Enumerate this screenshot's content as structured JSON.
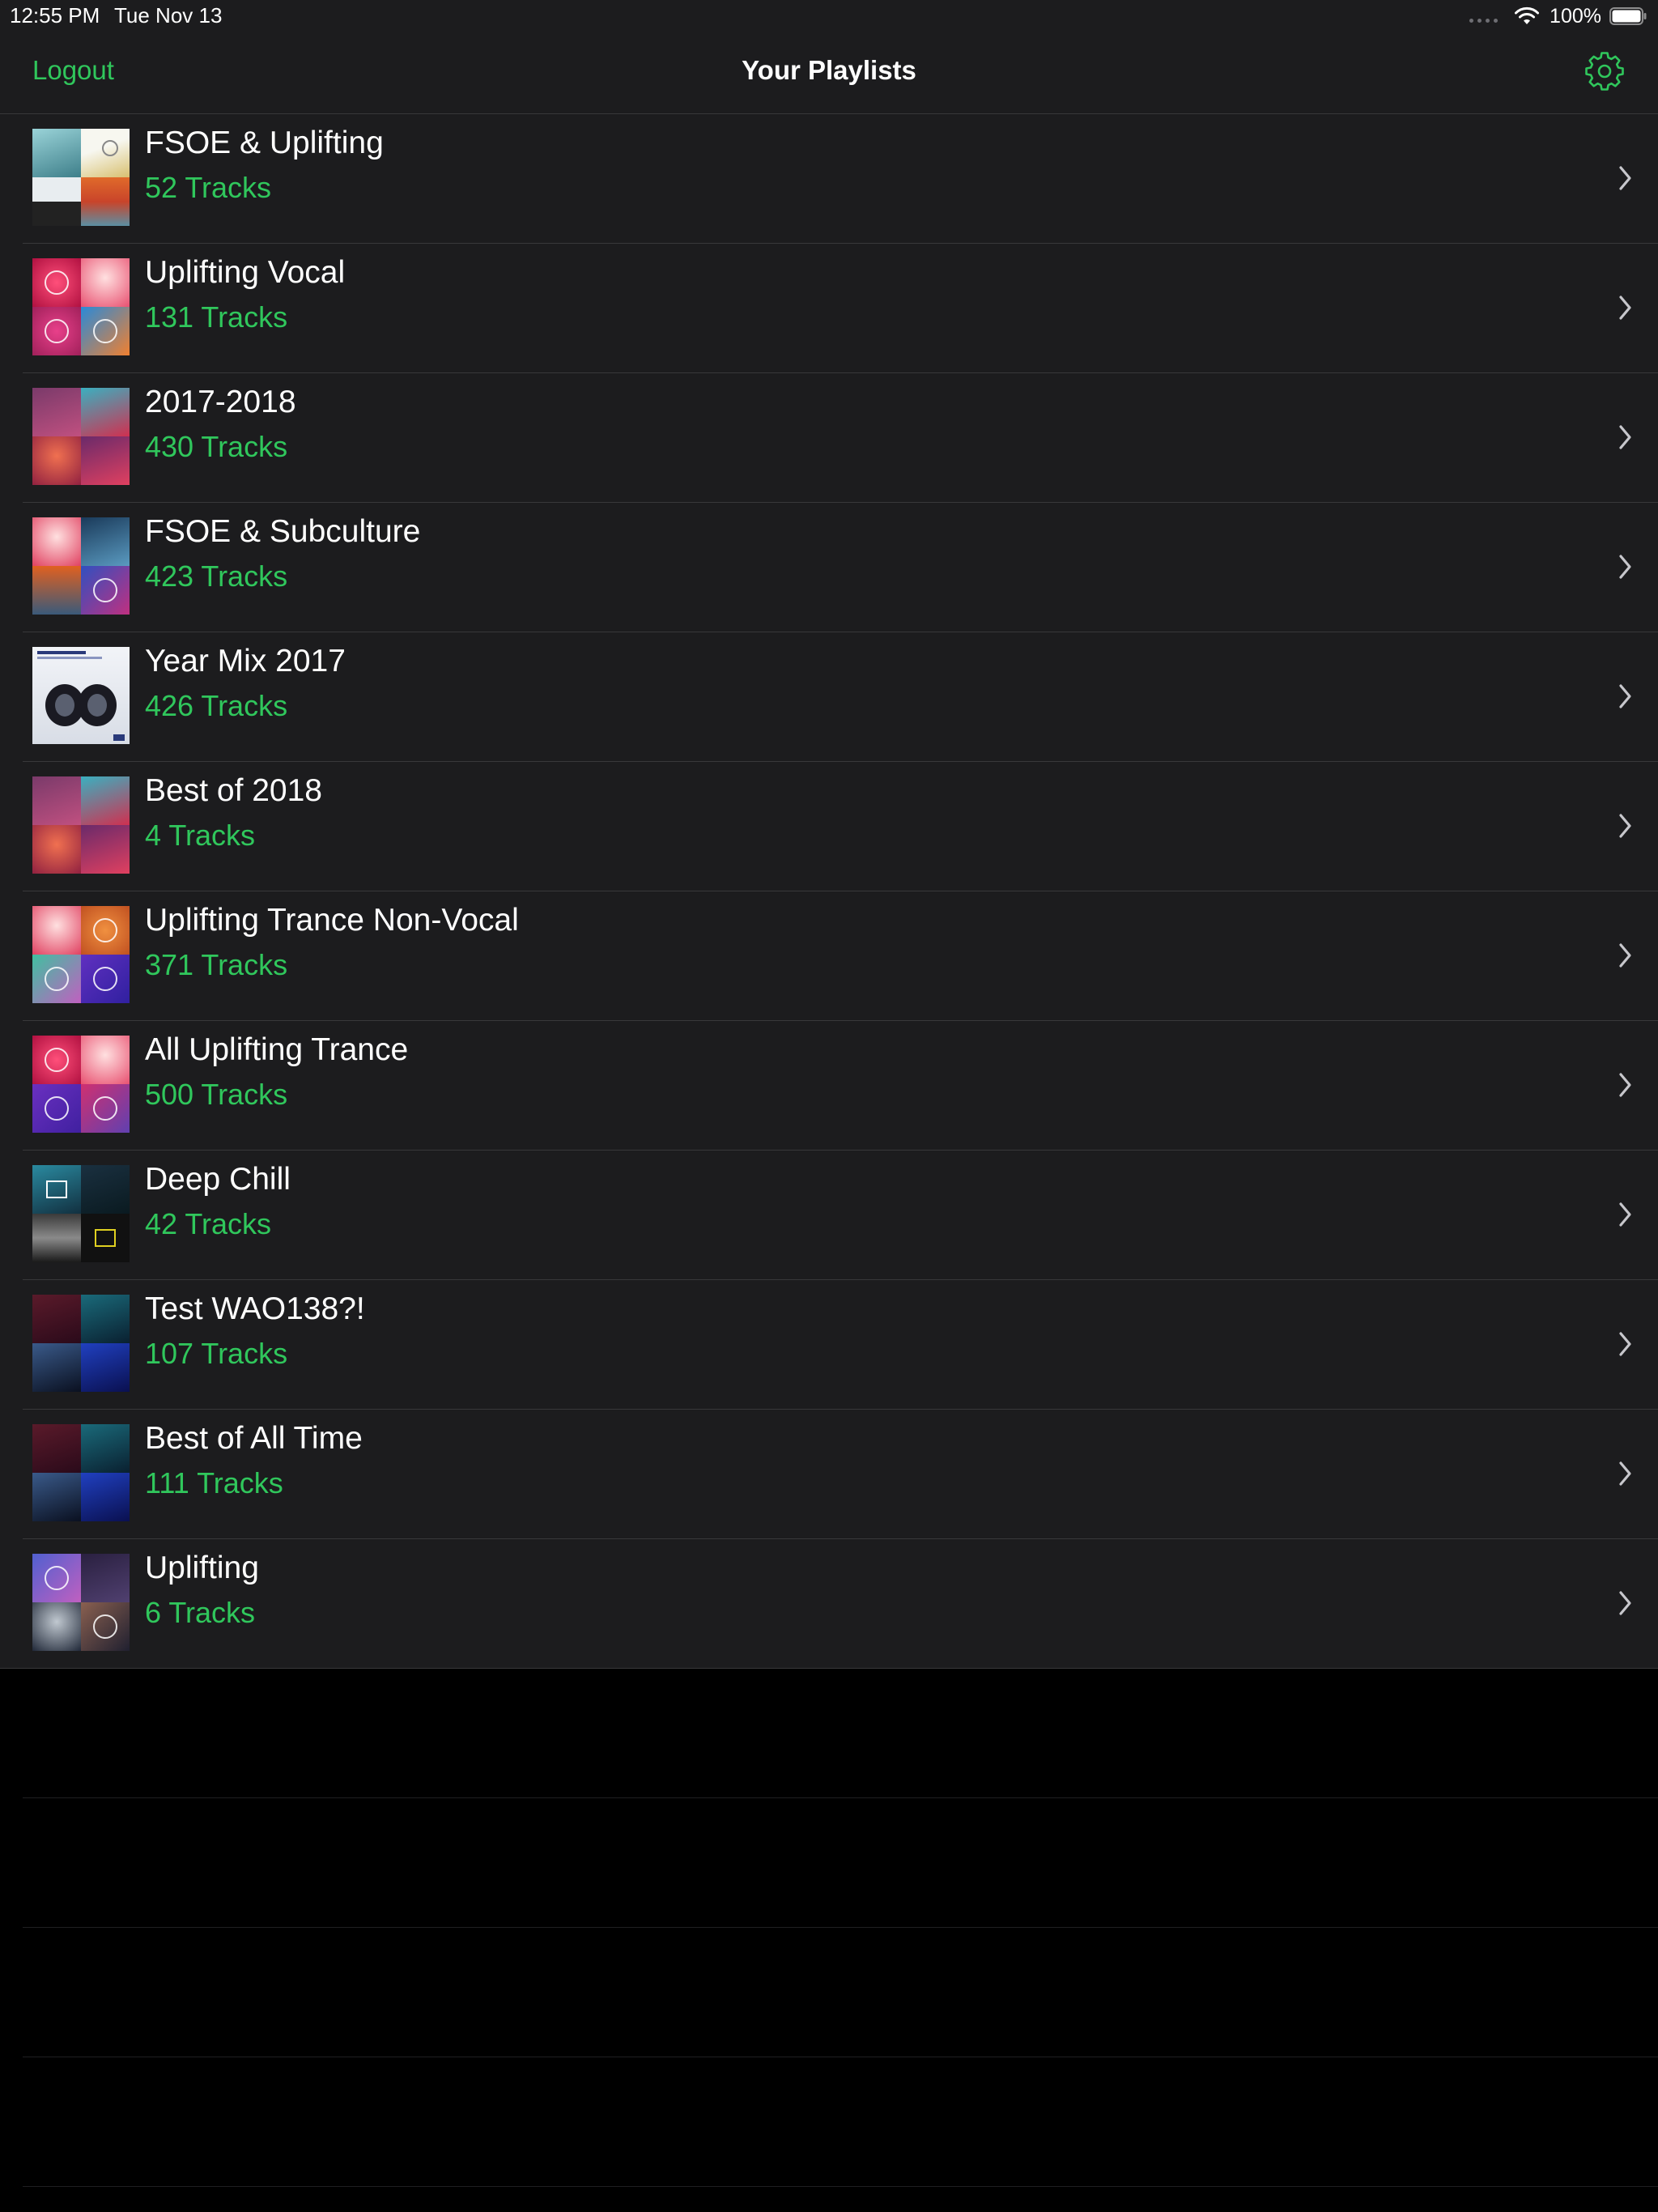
{
  "status_bar": {
    "time": "12:55 PM",
    "date": "Tue Nov 13",
    "battery": "100%"
  },
  "nav": {
    "logout_label": "Logout",
    "title": "Your Playlists",
    "settings_icon": "gear-icon"
  },
  "colors": {
    "accent": "#30c75c",
    "background": "#1c1c1e",
    "separator": "#38383a"
  },
  "playlists": [
    {
      "name": "FSOE & Uplifting",
      "count": "52 Tracks"
    },
    {
      "name": "Uplifting Vocal",
      "count": "131 Tracks"
    },
    {
      "name": "2017-2018",
      "count": "430 Tracks"
    },
    {
      "name": "FSOE & Subculture",
      "count": "423 Tracks"
    },
    {
      "name": "Year Mix 2017",
      "count": "426 Tracks"
    },
    {
      "name": "Best of 2018",
      "count": "4 Tracks"
    },
    {
      "name": "Uplifting Trance Non-Vocal",
      "count": "371 Tracks"
    },
    {
      "name": "All Uplifting Trance",
      "count": "500 Tracks"
    },
    {
      "name": "Deep Chill",
      "count": "42 Tracks"
    },
    {
      "name": "Test WAO138?!",
      "count": "107 Tracks"
    },
    {
      "name": "Best of All Time",
      "count": "111 Tracks"
    },
    {
      "name": "Uplifting",
      "count": "6 Tracks"
    }
  ]
}
